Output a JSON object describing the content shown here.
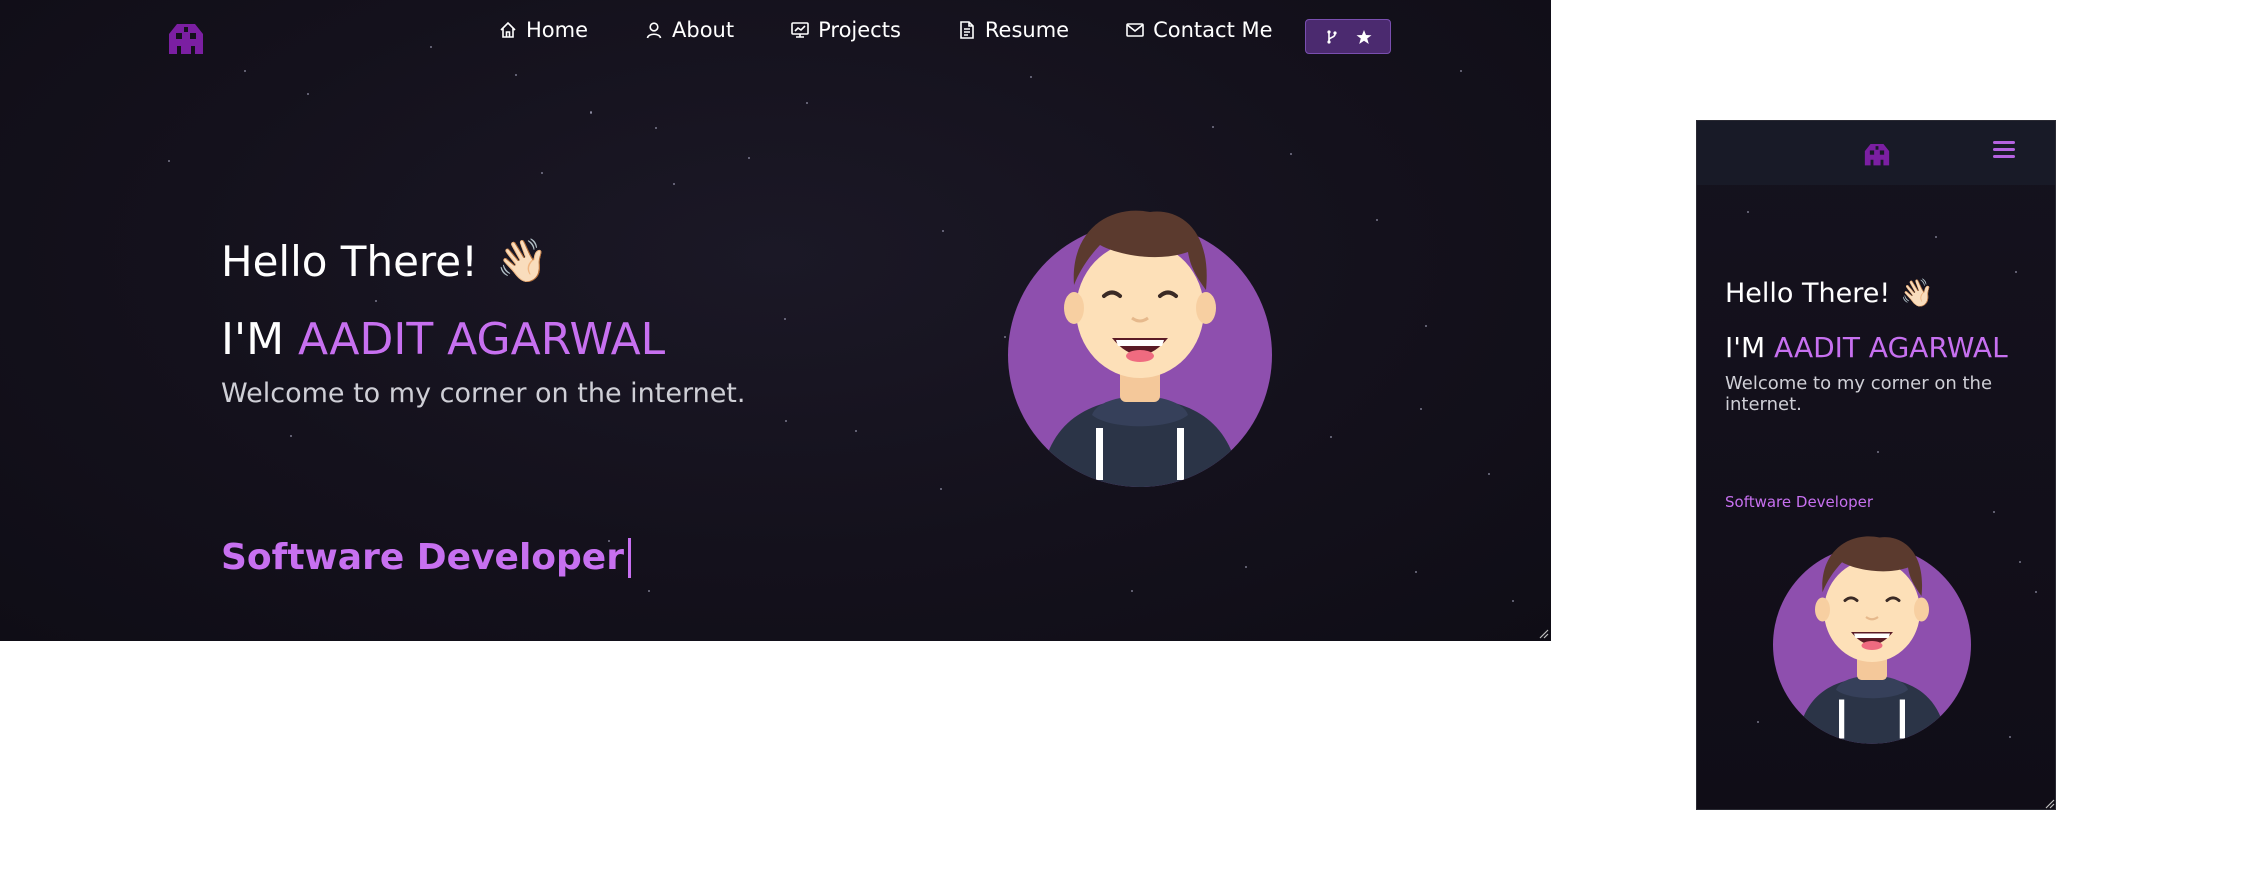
{
  "nav": {
    "items": [
      {
        "label": "Home",
        "icon": "home-icon"
      },
      {
        "label": "About",
        "icon": "user-icon"
      },
      {
        "label": "Projects",
        "icon": "projects-icon"
      },
      {
        "label": "Resume",
        "icon": "document-icon"
      },
      {
        "label": "Contact Me",
        "icon": "mail-icon"
      }
    ],
    "github_button": {
      "icons": [
        "fork-icon",
        "star-icon"
      ]
    }
  },
  "hero": {
    "greeting": "Hello There!",
    "wave_emoji": "👋🏻",
    "prefix": "I'M ",
    "name": "AADIT AGARWAL",
    "welcome": "Welcome to my corner on the internet.",
    "typed_text": "Software Developer"
  },
  "mobile": {
    "greeting": "Hello There!",
    "wave_emoji": "👋🏻",
    "prefix": "I'M ",
    "name": "AADIT AGARWAL",
    "welcome": "Welcome to my corner on the internet.",
    "typed_text": "Software Developer"
  },
  "colors": {
    "accent": "#c770f0",
    "logo": "#7b1fa2",
    "avatar_bg": "#8e4fae",
    "background": "#14111c"
  }
}
